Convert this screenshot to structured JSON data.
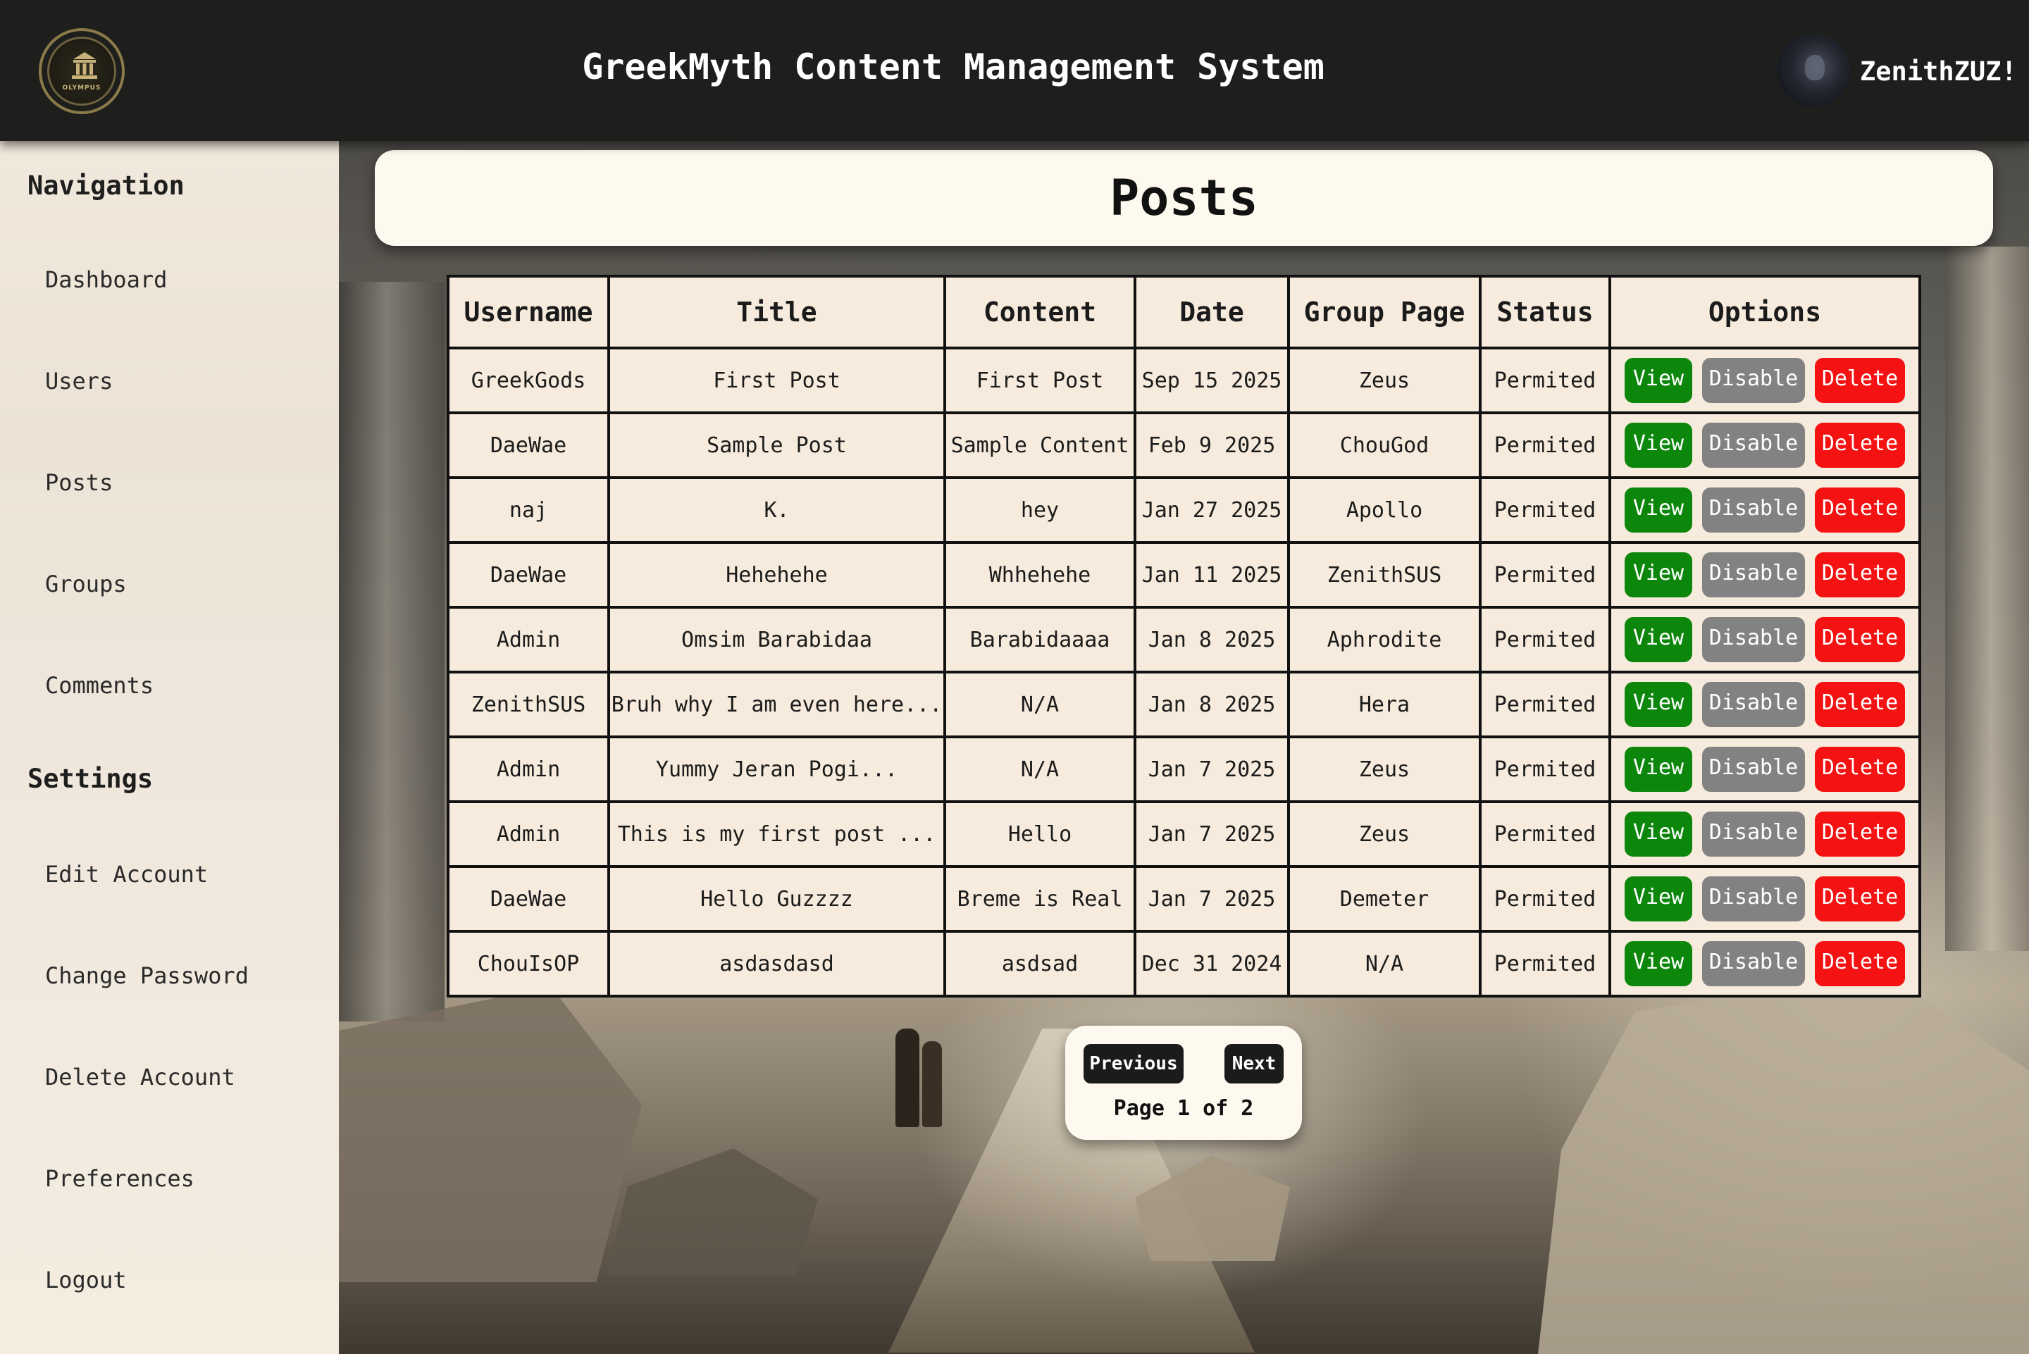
{
  "header": {
    "logo_text": "OLYMPUS",
    "title": "GreekMyth Content Management System",
    "username": "ZenithZUZ!"
  },
  "sidebar": {
    "navigation_heading": "Navigation",
    "nav_items": [
      "Dashboard",
      "Users",
      "Posts",
      "Groups",
      "Comments"
    ],
    "settings_heading": "Settings",
    "settings_items": [
      "Edit Account",
      "Change Password",
      "Delete Account",
      "Preferences",
      "Logout"
    ]
  },
  "page": {
    "title": "Posts"
  },
  "table": {
    "columns": [
      "Username",
      "Title",
      "Content",
      "Date",
      "Group Page",
      "Status",
      "Options"
    ],
    "rows": [
      {
        "username": "GreekGods",
        "title": "First Post",
        "content": "First Post",
        "date": "Sep 15 2025",
        "group": "Zeus",
        "status": "Permited"
      },
      {
        "username": "DaeWae",
        "title": "Sample Post",
        "content": "Sample Content",
        "date": "Feb 9 2025",
        "group": "ChouGod",
        "status": "Permited"
      },
      {
        "username": "naj",
        "title": "K.",
        "content": "hey",
        "date": "Jan 27 2025",
        "group": "Apollo",
        "status": "Permited"
      },
      {
        "username": "DaeWae",
        "title": "Hehehehe",
        "content": "Whhehehe",
        "date": "Jan 11 2025",
        "group": "ZenithSUS",
        "status": "Permited"
      },
      {
        "username": "Admin",
        "title": "Omsim Barabidaa",
        "content": "Barabidaaaa",
        "date": "Jan 8 2025",
        "group": "Aphrodite",
        "status": "Permited"
      },
      {
        "username": "ZenithSUS",
        "title": "Bruh why I am even here...",
        "content": "N/A",
        "date": "Jan 8 2025",
        "group": "Hera",
        "status": "Permited"
      },
      {
        "username": "Admin",
        "title": "Yummy Jeran Pogi...",
        "content": "N/A",
        "date": "Jan 7 2025",
        "group": "Zeus",
        "status": "Permited"
      },
      {
        "username": "Admin",
        "title": "This is my first post ...",
        "content": "Hello",
        "date": "Jan 7 2025",
        "group": "Zeus",
        "status": "Permited"
      },
      {
        "username": "DaeWae",
        "title": "Hello Guzzzz",
        "content": "Breme is Real",
        "date": "Jan 7 2025",
        "group": "Demeter",
        "status": "Permited"
      },
      {
        "username": "ChouIsOP",
        "title": "asdasdasd",
        "content": "asdsad",
        "date": "Dec 31 2024",
        "group": "N/A",
        "status": "Permited"
      }
    ],
    "actions": {
      "view": "View",
      "disable": "Disable",
      "delete": "Delete"
    }
  },
  "pagination": {
    "previous_label": "Previous",
    "next_label": "Next",
    "info": "Page 1 of 2"
  },
  "colors": {
    "header_bg": "#1e1f1c",
    "sidebar_bg": "#f1e8dc",
    "table_bg": "#f6ebdc",
    "view_btn": "#0c870c",
    "disable_btn": "#828282",
    "delete_btn": "#f41212"
  }
}
